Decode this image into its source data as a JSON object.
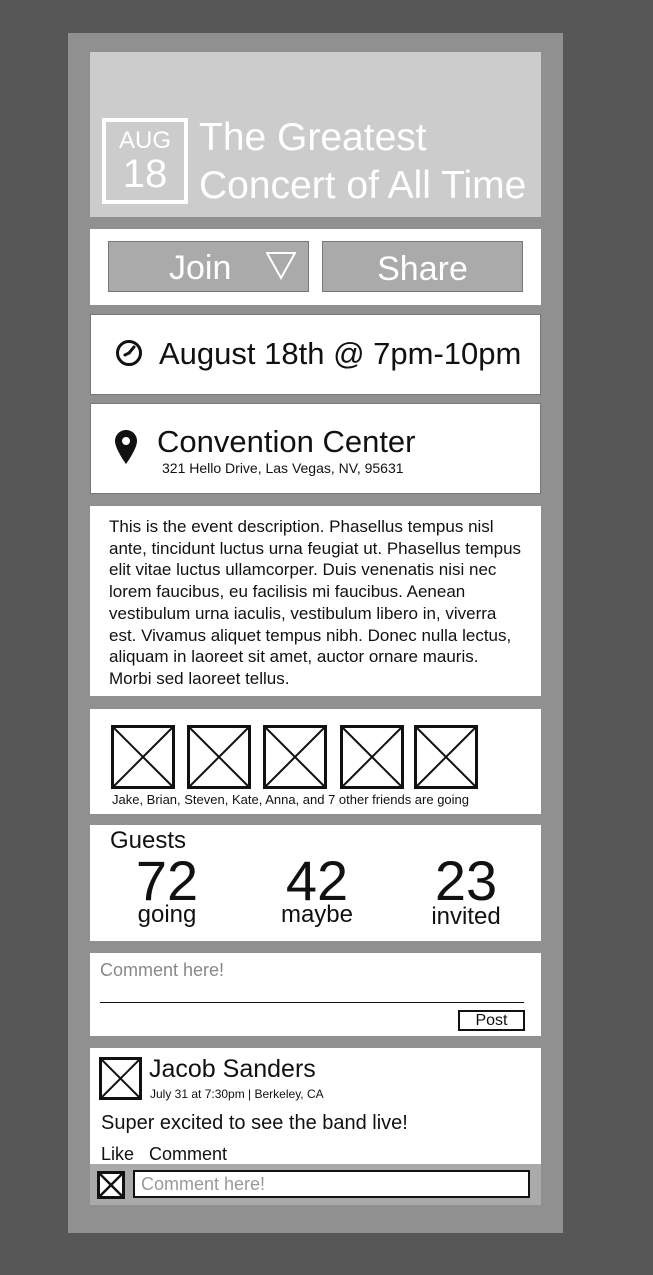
{
  "event": {
    "month": "AUG",
    "day": "18",
    "title": "The Greatest\nConcert of All Time"
  },
  "actions": {
    "join_label": "Join",
    "share_label": "Share"
  },
  "time": {
    "icon": "clock-icon",
    "text": "August 18th @ 7pm-10pm"
  },
  "location": {
    "icon": "map-pin-icon",
    "venue": "Convention Center",
    "address": "321 Hello Drive, Las Vegas, NV, 95631"
  },
  "description": "This is the event description. Phasellus tempus nisl ante, tincidunt luctus urna feugiat ut. Phasellus tempus elit vitae luctus ullamcorper. Duis venenatis nisi nec lorem faucibus, eu facilisis mi faucibus. Aenean vestibulum urna iaculis, vestibulum libero in, viverra est. Vivamus aliquet tempus nibh. Donec nulla lectus, aliquam in laoreet sit amet, auctor ornare mauris. Morbi sed laoreet tellus.",
  "friends": {
    "text": "Jake, Brian, Steven, Kate, Anna, and 7 other friends are going"
  },
  "guests": {
    "label": "Guests",
    "stats": [
      {
        "num": "72",
        "label": "going"
      },
      {
        "num": "42",
        "label": "maybe"
      },
      {
        "num": "23",
        "label": "invited"
      }
    ]
  },
  "comment_box": {
    "placeholder": "Comment here!",
    "post_label": "Post"
  },
  "post": {
    "author": "Jacob Sanders",
    "meta": "July 31 at 7:30pm | Berkeley, CA",
    "body": "Super excited to see the band live!",
    "like_label": "Like",
    "comment_label": "Comment",
    "reply_placeholder": "Comment here!"
  }
}
